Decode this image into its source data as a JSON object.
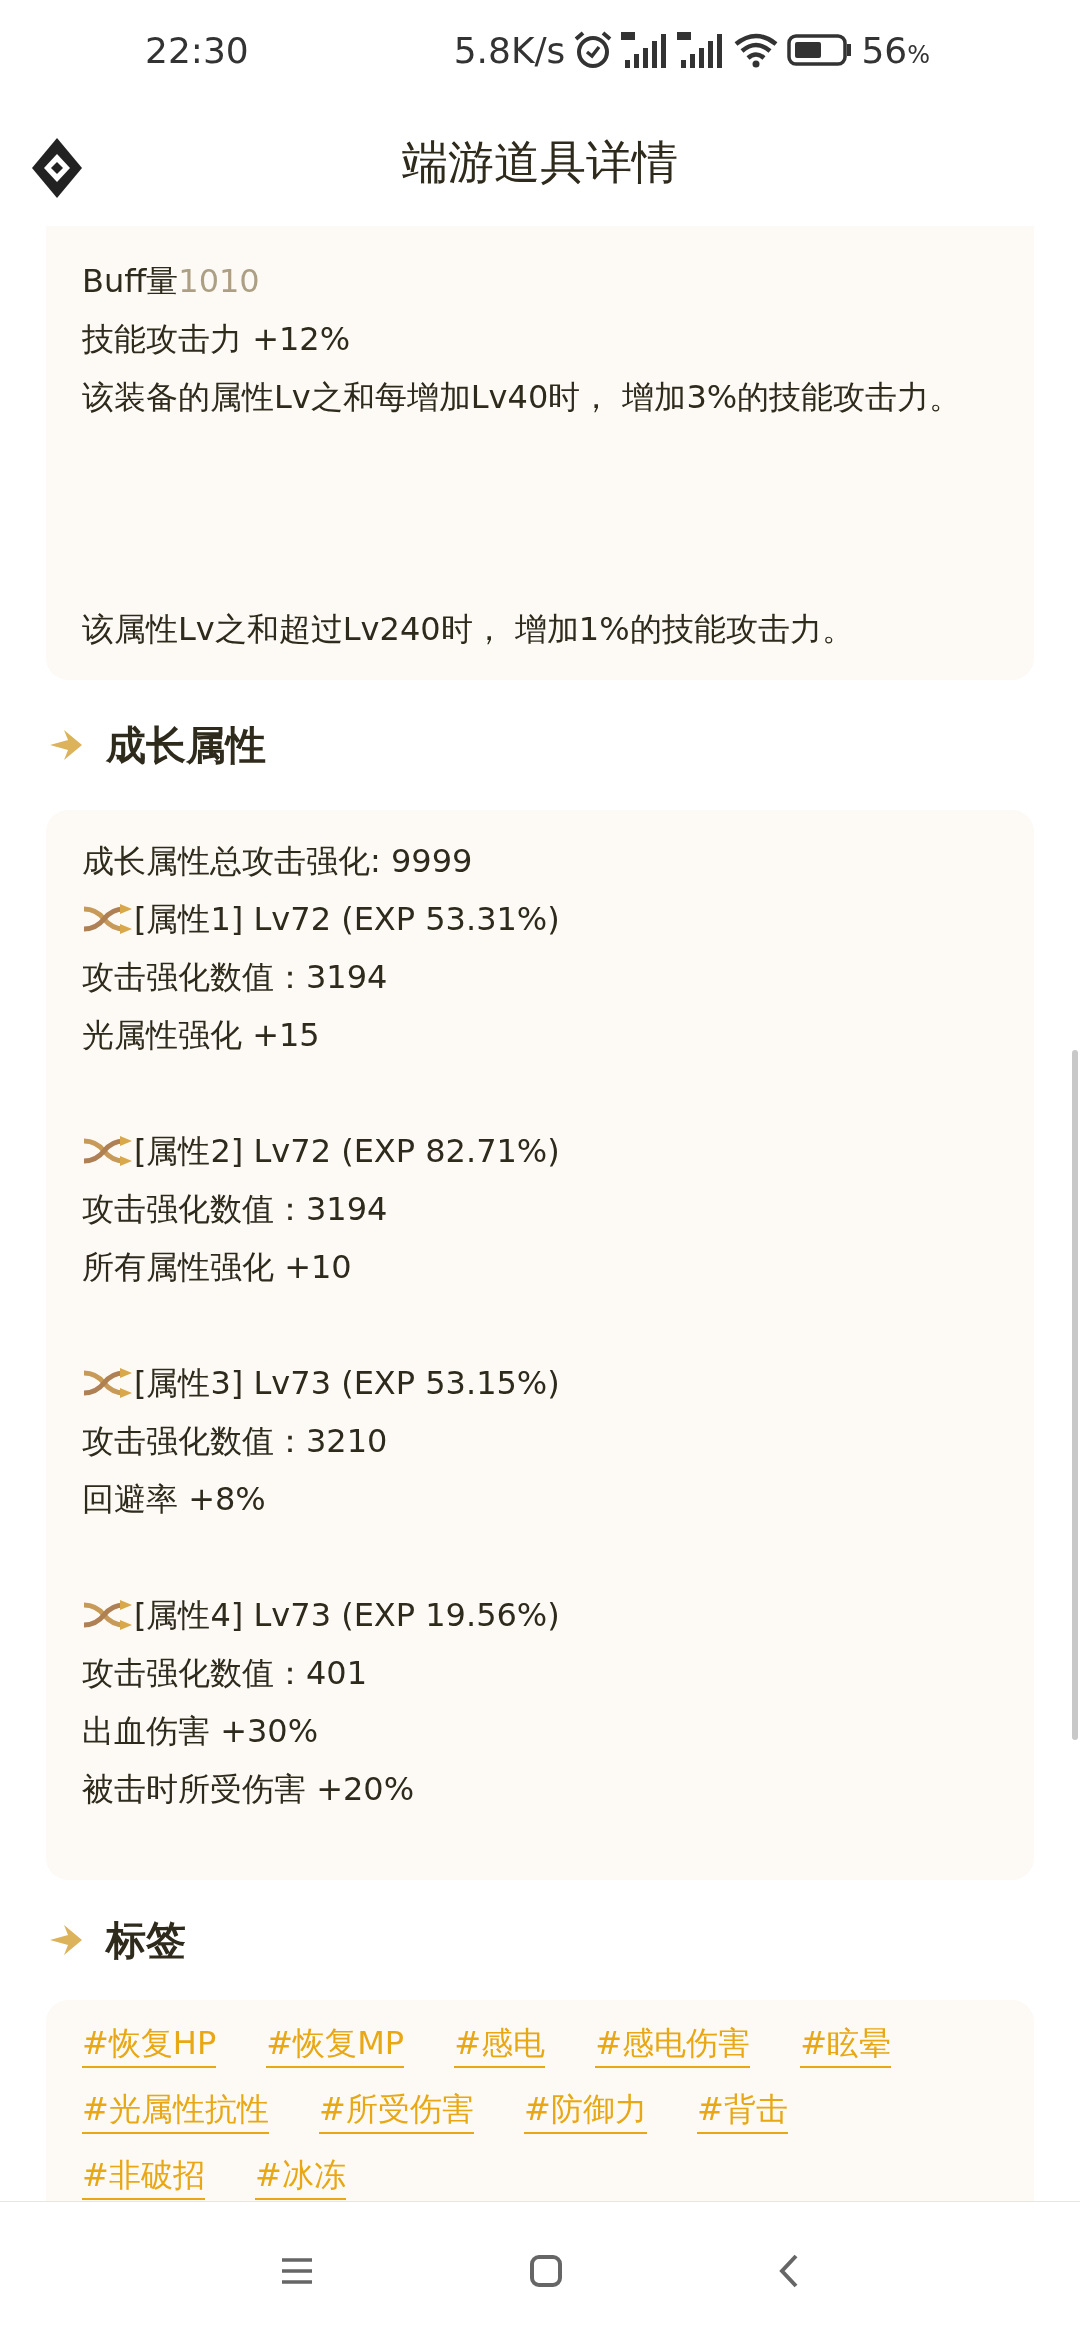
{
  "status_bar": {
    "time": "22:30",
    "net_speed": "5.8K/s",
    "battery": "56",
    "battery_unit": "%"
  },
  "header": {
    "title": "端游道具详情"
  },
  "effects_card": {
    "stats": [
      {
        "label": "Buff量",
        "value": "1010"
      }
    ],
    "lines": [
      "技能攻击力 +12%",
      "该装备的属性Lv之和每增加Lv40时， 增加3%的技能攻击力。"
    ],
    "footer": "该属性Lv之和超过Lv240时， 增加1%的技能攻击力。"
  },
  "growth": {
    "heading": "成长属性",
    "summary": "成长属性总攻击强化: 9999",
    "attributes": [
      {
        "title": "[属性1] Lv72 (EXP 53.31%)",
        "lines": [
          "攻击强化数值：3194",
          "光属性强化 +15"
        ]
      },
      {
        "title": "[属性2] Lv72 (EXP 82.71%)",
        "lines": [
          "攻击强化数值：3194",
          "所有属性强化 +10"
        ]
      },
      {
        "title": "[属性3] Lv73 (EXP 53.15%)",
        "lines": [
          "攻击强化数值：3210",
          "回避率 +8%"
        ]
      },
      {
        "title": "[属性4] Lv73 (EXP 19.56%)",
        "lines": [
          "攻击强化数值：401",
          "出血伤害 +30%",
          "被击时所受伤害 +20%"
        ]
      }
    ]
  },
  "tags": {
    "heading": "标签",
    "items": [
      "#恢复HP",
      "#恢复MP",
      "#感电",
      "#感电伤害",
      "#眩晕",
      "#光属性抗性",
      "#所受伤害",
      "#防御力",
      "#背击",
      "#非破招",
      "#冰冻"
    ]
  }
}
